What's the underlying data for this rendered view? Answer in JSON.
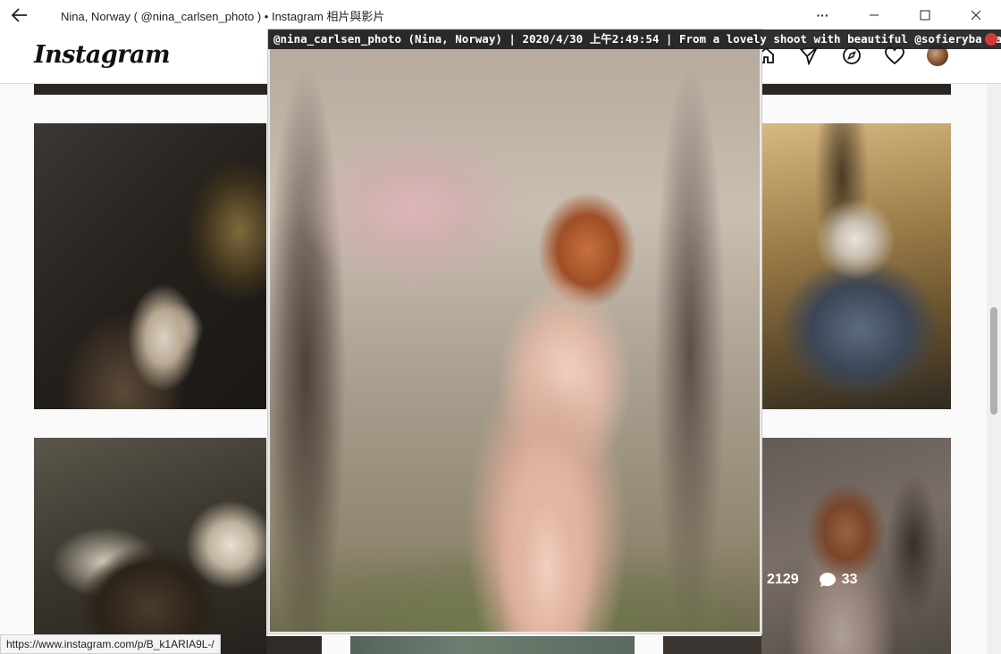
{
  "window": {
    "title": "Nina, Norway ( @nina_carlsen_photo ) • Instagram 相片與影片",
    "more_label": "···"
  },
  "header": {
    "logo_text": "Instagram",
    "nav_icons": [
      "home-icon",
      "direct-icon",
      "explore-icon",
      "heart-icon",
      "avatar"
    ]
  },
  "popup": {
    "caption": "@nina_carlsen_photo (Nina, Norway) | 2020/4/30 上午2:49:54 | From a lovely shoot with beautiful @sofieryba last spring"
  },
  "post_stats": {
    "likes": "2129",
    "comments": "33"
  },
  "status_bar": {
    "url": "https://www.instagram.com/p/B_k1ARIA9L-/"
  },
  "scroll": {
    "position_fraction": 0.39
  }
}
